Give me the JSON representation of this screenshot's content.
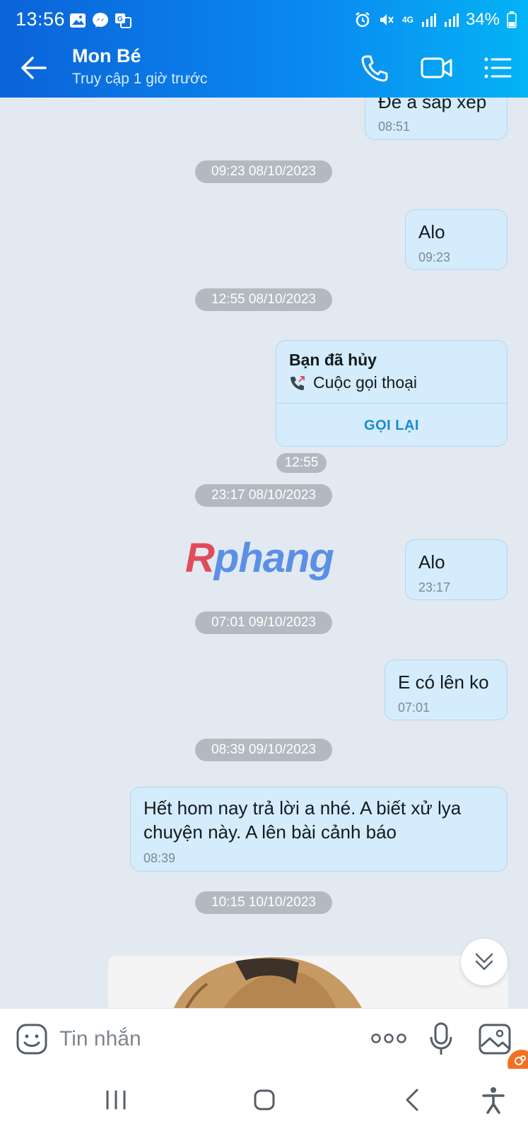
{
  "status_bar": {
    "time": "13:56",
    "battery": "34%",
    "network": "4G",
    "left_icons": [
      "gallery-icon",
      "messenger-icon",
      "translate-icon"
    ],
    "right_icons": [
      "alarm-icon",
      "mute-icon",
      "signal-icon",
      "signal-icon",
      "battery-icon"
    ]
  },
  "header": {
    "contact_name": "Mon Bé",
    "contact_status": "Truy cập 1 giờ trước",
    "icons": [
      "back-arrow-icon",
      "phone-icon",
      "video-icon",
      "list-menu-icon"
    ]
  },
  "chat": {
    "partial_top_message": {
      "text": "Để a sắp xếp",
      "time": "08:51"
    },
    "date_separators": [
      "09:23 08/10/2023",
      "12:55 08/10/2023",
      "23:17 08/10/2023",
      "07:01 09/10/2023",
      "08:39 09/10/2023",
      "10:15 10/10/2023"
    ],
    "messages": [
      {
        "text": "Alo",
        "time": "09:23"
      },
      {
        "text": "Alo",
        "time": "23:17"
      },
      {
        "text": "E có lên ko",
        "time": "07:01"
      },
      {
        "text": "Hết hom nay trả lời a nhé. A biết xử lya chuyện này. A lên bài cảnh báo",
        "time": "08:39"
      }
    ],
    "call_card": {
      "title": "Bạn đã hủy",
      "type": "Cuộc gọi thoại",
      "action": "GỌI LẠI",
      "time": "12:55"
    },
    "watermark": {
      "part1": "R",
      "part2": "phang"
    }
  },
  "input_bar": {
    "placeholder": "Tin nhắn",
    "icons": [
      "sticker-icon",
      "more-dots-icon",
      "microphone-icon",
      "image-icon"
    ]
  },
  "nav_bar": {
    "icons": [
      "recent-apps-icon",
      "home-icon",
      "back-icon",
      "accessibility-icon"
    ]
  },
  "colors": {
    "header_gradient_start": "#0b63d9",
    "header_gradient_end": "#04b3f5",
    "chat_background": "#e2e9f1",
    "bubble": "#d4ecfb",
    "date_pill": "#b3b9c0",
    "call_again": "#1a8ad1"
  }
}
